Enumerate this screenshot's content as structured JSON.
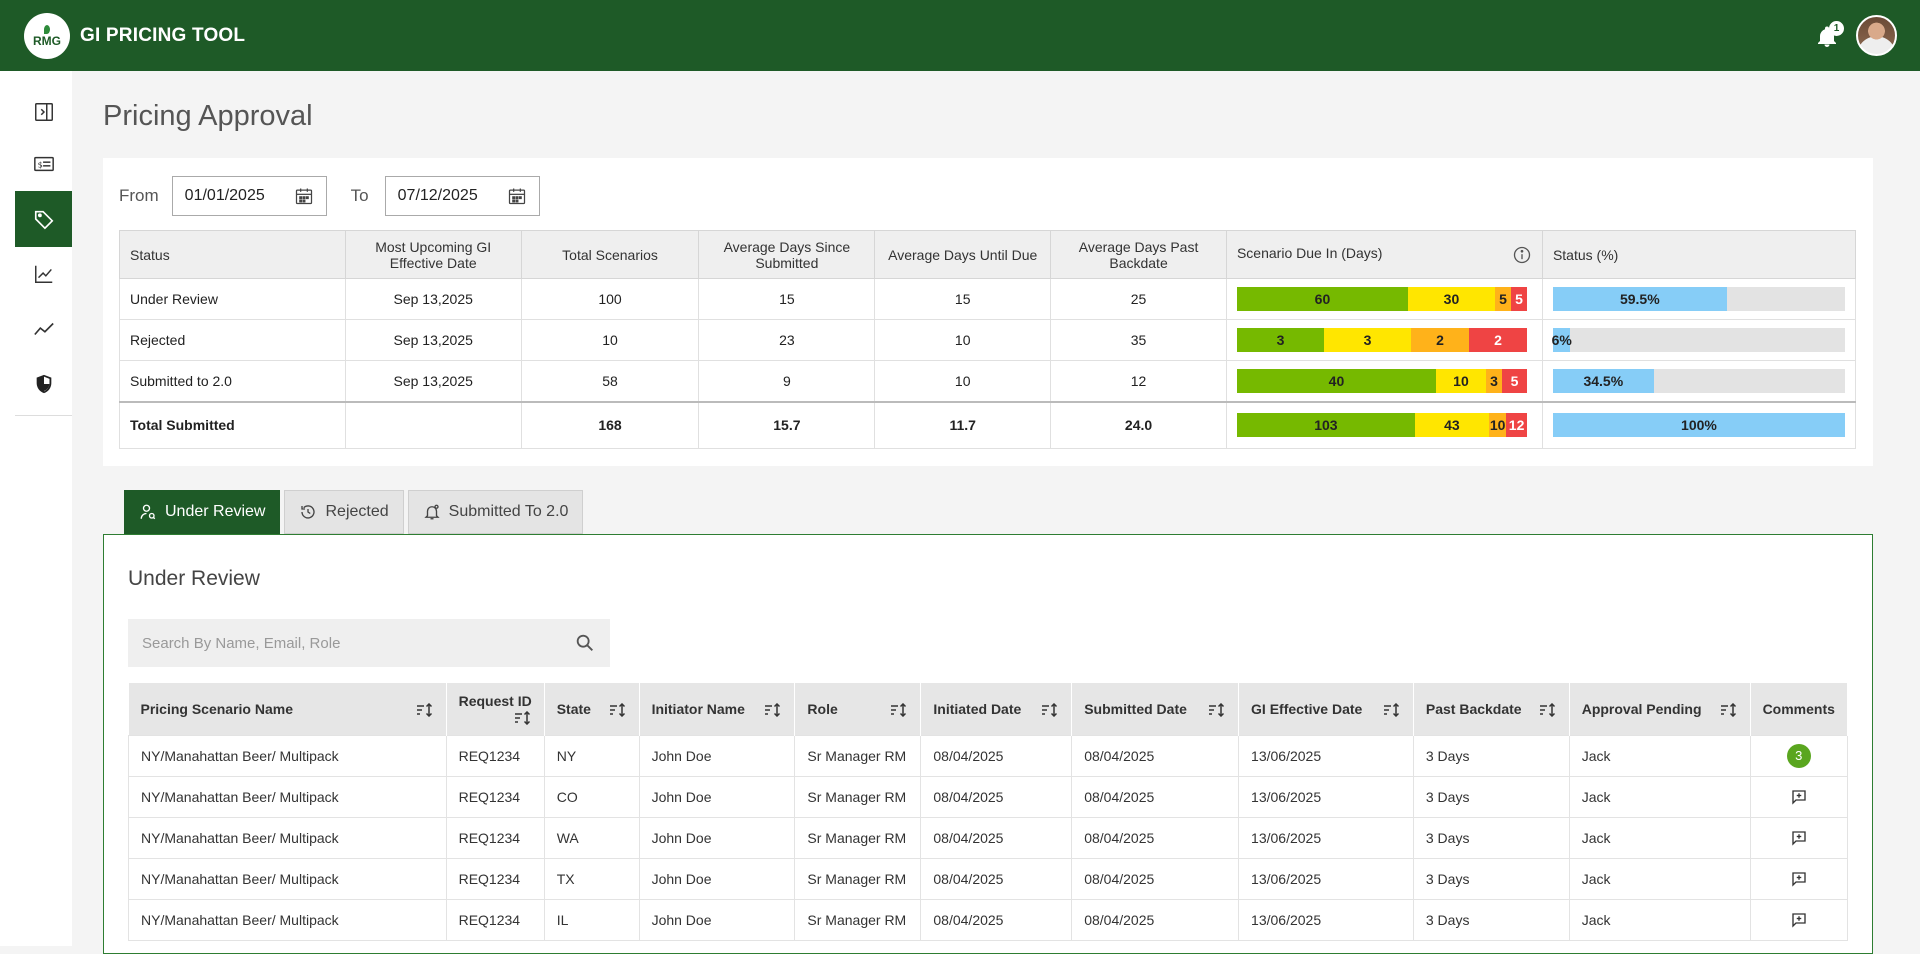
{
  "app": {
    "logo_text": "RMG",
    "title": "GI PRICING TOOL",
    "notification_count": "1"
  },
  "page": {
    "title": "Pricing Approval"
  },
  "filters": {
    "from_label": "From",
    "from_value": "01/01/2025",
    "to_label": "To",
    "to_value": "07/12/2025"
  },
  "summary": {
    "headers": [
      "Status",
      "Most Upcoming GI Effective Date",
      "Total Scenarios",
      "Average Days Since Submitted",
      "Average Days Until Due",
      "Average Days Past Backdate",
      "Scenario Due In (Days)",
      "Status (%)"
    ],
    "rows": [
      {
        "status": "Under Review",
        "date": "Sep 13,2025",
        "total": "100",
        "since": "15",
        "until": "15",
        "past": "25",
        "due": [
          60,
          30,
          5,
          5
        ],
        "pct": 59.5,
        "pct_label": "59.5%"
      },
      {
        "status": "Rejected",
        "date": "Sep 13,2025",
        "total": "10",
        "since": "23",
        "until": "10",
        "past": "35",
        "due": [
          3,
          3,
          2,
          2
        ],
        "pct": 6,
        "pct_label": "6%"
      },
      {
        "status": "Submitted to 2.0",
        "date": "Sep 13,2025",
        "total": "58",
        "since": "9",
        "until": "10",
        "past": "12",
        "due": [
          40,
          10,
          3,
          5
        ],
        "pct": 34.5,
        "pct_label": "34.5%"
      }
    ],
    "total": {
      "status": "Total Submitted",
      "date": "",
      "total": "168",
      "since": "15.7",
      "until": "11.7",
      "past": "24.0",
      "due": [
        103,
        43,
        10,
        12
      ],
      "pct": 100,
      "pct_label": "100%"
    }
  },
  "due_colors": [
    "#76b900",
    "#ffe600",
    "#ffb21a",
    "#ef4444"
  ],
  "tabs": [
    {
      "label": "Under Review",
      "icon": "reviewer-icon",
      "active": true
    },
    {
      "label": "Rejected",
      "icon": "history-icon",
      "active": false
    },
    {
      "label": "Submitted To 2.0",
      "icon": "bell-settings-icon",
      "active": false
    }
  ],
  "panel": {
    "title": "Under Review",
    "search_placeholder": "Search By Name, Email, Role"
  },
  "grid": {
    "headers": [
      "Pricing Scenario Name",
      "Request ID",
      "State",
      "Initiator Name",
      "Role",
      "Initiated Date",
      "Submitted Date",
      "GI Effective Date",
      "Past Backdate",
      "Approval Pending",
      "Comments"
    ],
    "rows": [
      {
        "name": "NY/Manahattan Beer/ Multipack",
        "req": "REQ1234",
        "state": "NY",
        "initiator": "John Doe",
        "role": "Sr Manager RM",
        "initiated": "08/04/2025",
        "submitted": "08/04/2025",
        "effective": "13/06/2025",
        "past": "3 Days",
        "pending": "Jack",
        "comments": "3"
      },
      {
        "name": "NY/Manahattan Beer/ Multipack",
        "req": "REQ1234",
        "state": "CO",
        "initiator": "John Doe",
        "role": "Sr Manager RM",
        "initiated": "08/04/2025",
        "submitted": "08/04/2025",
        "effective": "13/06/2025",
        "past": "3 Days",
        "pending": "Jack",
        "comments": ""
      },
      {
        "name": "NY/Manahattan Beer/ Multipack",
        "req": "REQ1234",
        "state": "WA",
        "initiator": "John Doe",
        "role": "Sr Manager RM",
        "initiated": "08/04/2025",
        "submitted": "08/04/2025",
        "effective": "13/06/2025",
        "past": "3 Days",
        "pending": "Jack",
        "comments": ""
      },
      {
        "name": "NY/Manahattan Beer/ Multipack",
        "req": "REQ1234",
        "state": "TX",
        "initiator": "John Doe",
        "role": "Sr Manager RM",
        "initiated": "08/04/2025",
        "submitted": "08/04/2025",
        "effective": "13/06/2025",
        "past": "3 Days",
        "pending": "Jack",
        "comments": ""
      },
      {
        "name": "NY/Manahattan Beer/ Multipack",
        "req": "REQ1234",
        "state": "IL",
        "initiator": "John Doe",
        "role": "Sr Manager RM",
        "initiated": "08/04/2025",
        "submitted": "08/04/2025",
        "effective": "13/06/2025",
        "past": "3 Days",
        "pending": "Jack",
        "comments": ""
      }
    ]
  }
}
